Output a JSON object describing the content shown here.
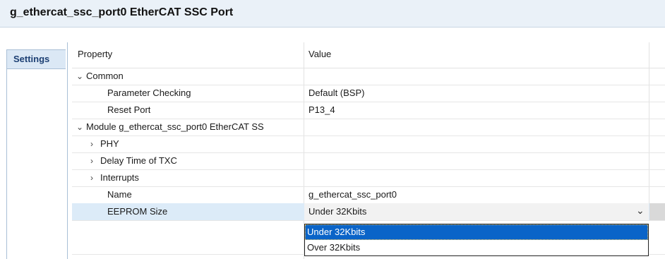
{
  "window": {
    "title": "g_ethercat_ssc_port0 EtherCAT SSC Port"
  },
  "sidebar": {
    "tabs": [
      {
        "label": "Settings"
      }
    ]
  },
  "grid": {
    "headers": {
      "property": "Property",
      "value": "Value"
    },
    "rows": [
      {
        "property": "Common",
        "value": "",
        "expander": "expanded"
      },
      {
        "property": "Parameter Checking",
        "value": "Default (BSP)",
        "expander": "none"
      },
      {
        "property": "Reset Port",
        "value": "P13_4",
        "expander": "none"
      },
      {
        "property": "Module g_ethercat_ssc_port0 EtherCAT SS",
        "value": "",
        "expander": "expanded"
      },
      {
        "property": "PHY",
        "value": "",
        "expander": "collapsed"
      },
      {
        "property": "Delay Time of TXC",
        "value": "",
        "expander": "collapsed"
      },
      {
        "property": "Interrupts",
        "value": "",
        "expander": "collapsed"
      },
      {
        "property": "Name",
        "value": "g_ethercat_ssc_port0",
        "expander": "none"
      },
      {
        "property": "EEPROM Size",
        "value": "Under 32Kbits",
        "expander": "none",
        "selected": true
      }
    ]
  },
  "dropdown": {
    "options": [
      {
        "label": "Under 32Kbits",
        "highlighted": true
      },
      {
        "label": "Over 32Kbits",
        "highlighted": false
      }
    ]
  },
  "icons": {
    "expanded": "chevron-down-icon",
    "collapsed": "chevron-right-icon",
    "dropdown": "chevron-down-icon"
  },
  "colors": {
    "title_bg": "#eaf1f8",
    "selected_row": "#dcebf8",
    "highlight": "#0a64c8"
  }
}
